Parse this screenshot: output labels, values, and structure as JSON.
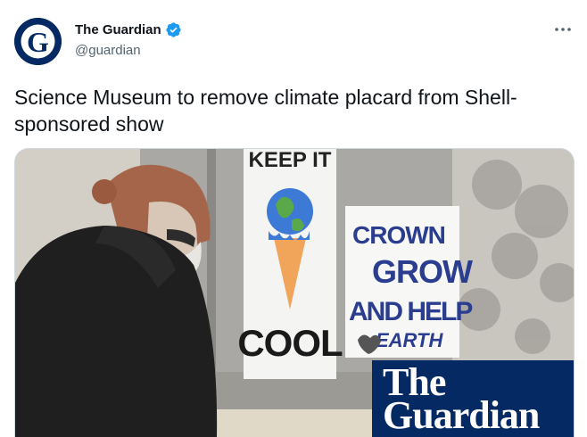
{
  "account": {
    "display_name": "The Guardian",
    "handle": "@guardian",
    "verified": true,
    "avatar_icon": "guardian-g-logo-icon",
    "brand_color": "#052962"
  },
  "tweet": {
    "text": "Science Museum to remove climate placard from Shell-sponsored show"
  },
  "menu": {
    "more_icon": "more-horizontal-icon"
  },
  "media": {
    "placard_left": {
      "top_text": "KEEP IT",
      "bottom_text": "COOL"
    },
    "placard_right": {
      "line1": "CROWN",
      "line2": "GROW",
      "line3": "AND HELP",
      "line4": "EARTH"
    },
    "logo": {
      "line1": "The",
      "line2": "Guardian"
    }
  },
  "colors": {
    "text_primary": "#0f1419",
    "text_secondary": "#536471",
    "verified_blue": "#1d9bf0",
    "guardian_navy": "#052962"
  }
}
